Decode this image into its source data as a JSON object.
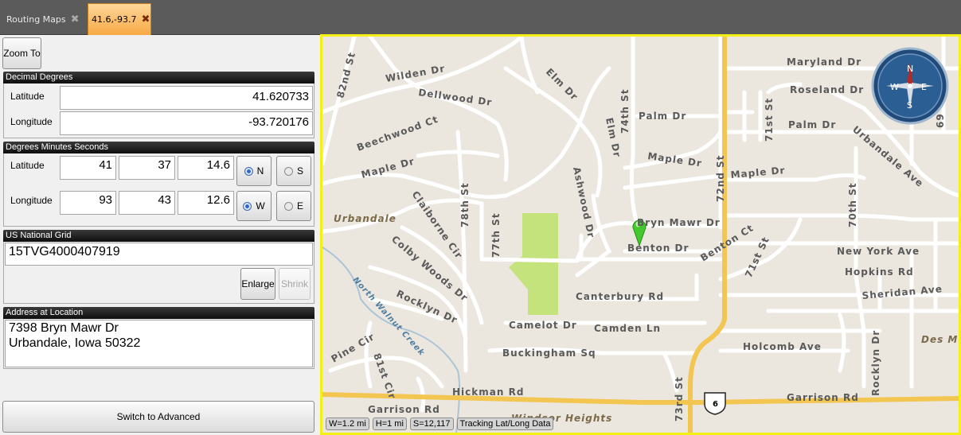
{
  "tabs": [
    {
      "label": "Routing Maps",
      "close": "✖"
    },
    {
      "label": "41.6,-93.7",
      "close": "✖"
    }
  ],
  "panel": {
    "zoom_to": "Zoom To",
    "decimal_degrees": {
      "title": "Decimal Degrees",
      "latitude_label": "Latitude",
      "latitude_value": "41.620733",
      "longitude_label": "Longitude",
      "longitude_value": "-93.720176"
    },
    "dms": {
      "title": "Degrees Minutes Seconds",
      "latitude_label": "Latitude",
      "lat_deg": "41",
      "lat_min": "37",
      "lat_sec": "14.6",
      "longitude_label": "Longitude",
      "lon_deg": "93",
      "lon_min": "43",
      "lon_sec": "12.6",
      "north": "N",
      "south": "S",
      "west": "W",
      "east": "E",
      "lat_selected": "N",
      "lon_selected": "W"
    },
    "usng": {
      "title": "US National Grid",
      "value": "15TVG4000407919",
      "enlarge": "Enlarge",
      "shrink": "Shrink"
    },
    "address": {
      "title": "Address at Location",
      "line1": "7398 Bryn Mawr Dr",
      "line2": "Urbandale, Iowa  50322"
    },
    "switch": "Switch to Advanced"
  },
  "map": {
    "compass": {
      "n": "N",
      "e": "E",
      "s": "S",
      "w": "W"
    },
    "shield": "6",
    "status": [
      "W=1.2 mi",
      "H=1 mi",
      "S=12,117",
      "Tracking Lat/Long Data"
    ],
    "labels": {
      "maryland": "Maryland Dr",
      "roseland": "Roseland Dr",
      "palm_dr_e": "Palm Dr",
      "palm_dr": "Palm Dr",
      "wilden": "Wilden Dr",
      "dellwood": "Dellwood Dr",
      "elm1": "Elm Dr",
      "elm2": "Elm Dr",
      "st82": "82nd St",
      "st74": "74th St",
      "beechwood": "Beechwood Ct",
      "maple1": "Maple Dr",
      "maple2": "Maple Dr",
      "maple3": "Maple Dr",
      "st71": "71st St",
      "urbandale_ave": "Urbandale Ave",
      "st78": "78th St",
      "st77": "77th St",
      "ashwood": "Ashwood Dr",
      "st72": "72nd St",
      "st70": "70th St",
      "urbandale": "Urbandale",
      "claiborne": "Claiborne Cir",
      "colby": "Colby Woods Dr",
      "bryn": "Bryn Mawr Dr",
      "benton": "Benton Dr",
      "benton_ct": "Benton Ct",
      "st71b": "71st St",
      "newyork": "New York Ave",
      "hopkins": "Hopkins Rd",
      "sheridan": "Sheridan Ave",
      "nwalnut": "North Walnut Creek",
      "rocklyn": "Rocklyn Dr",
      "rocklyn2": "Rocklyn Dr",
      "canterbury": "Canterbury Rd",
      "camelot": "Camelot Dr",
      "camden": "Camden Ln",
      "buckingham": "Buckingham Sq",
      "holcomb": "Holcomb Ave",
      "desm": "Des M",
      "pine": "Pine Cir",
      "st81": "81st Cir",
      "hickman": "Hickman Rd",
      "garrison1": "Garrison Rd",
      "garrison2": "Garrison Rd",
      "st73": "73rd St",
      "windsor": "Windsor Heights",
      "st69": "69"
    }
  }
}
